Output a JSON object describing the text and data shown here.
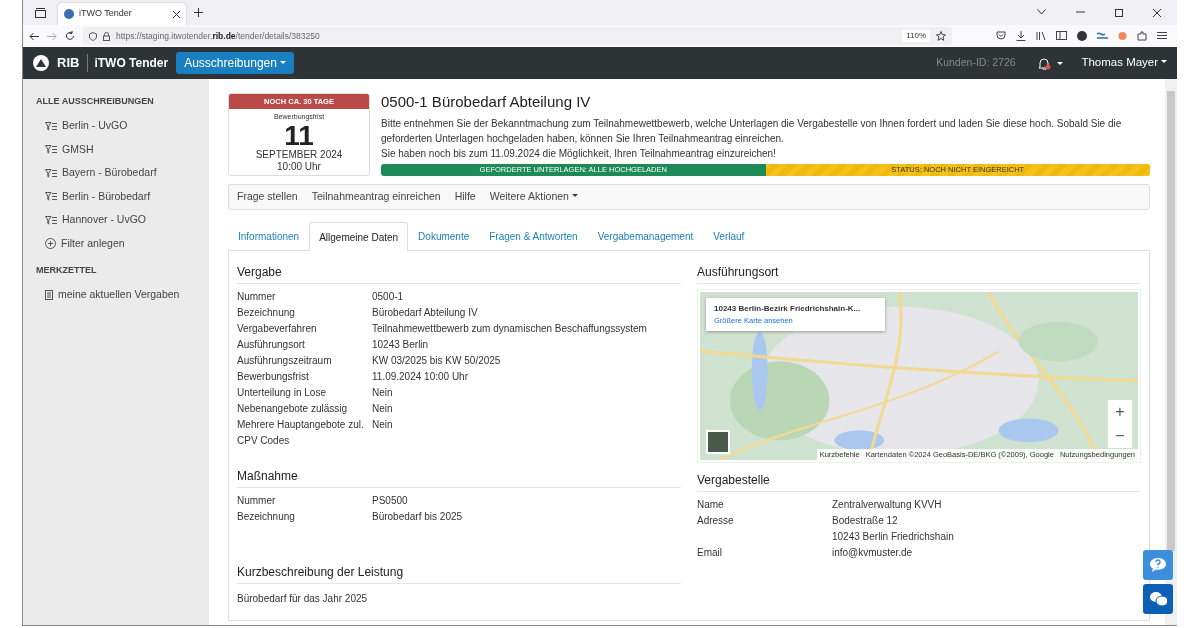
{
  "browser": {
    "tab_title": "iTWO Tender",
    "url_prefix": "https://staging.itwotender.",
    "url_domain": "rib.de",
    "url_path": "/tender/details/383250",
    "zoom": "110%"
  },
  "navbar": {
    "brand": "RIB",
    "product": "iTWO Tender",
    "menu_button": "Ausschreibungen",
    "customer_id": "Kunden-ID: 2726",
    "notification": true,
    "user": "Thomas Mayer"
  },
  "sidebar": {
    "sections": [
      {
        "heading": "ALLE AUSSCHREIBUNGEN",
        "items": [
          {
            "label": "Berlin - UvGO",
            "kind": "filter"
          },
          {
            "label": "GMSH",
            "kind": "filter"
          },
          {
            "label": "Bayern - Bürobedarf",
            "kind": "filter"
          },
          {
            "label": "Berlin - Bürobedarf",
            "kind": "filter"
          },
          {
            "label": "Hannover - UvGO",
            "kind": "filter"
          },
          {
            "label": "Filter anlegen",
            "kind": "add"
          }
        ]
      },
      {
        "heading": "MERKZETTEL",
        "items": [
          {
            "label": "meine aktuellen Vergaben",
            "kind": "document"
          }
        ]
      }
    ]
  },
  "deadline": {
    "badge": "NOCH CA. 30 TAGE",
    "label": "Bewerbungsfrist",
    "day": "11",
    "month_year": "SEPTEMBER 2024",
    "time": "10:00 Uhr"
  },
  "title": "0500-1 Bürobedarf Abteilung IV",
  "intro": [
    "Bitte entnehmen Sie der Bekanntmachung zum Teilnahmewettbewerb, welche Unterlagen die Vergabestelle von Ihnen fordert und laden Sie diese hoch. Sobald Sie die geforderten Unterlagen hochgeladen haben, können Sie Ihren Teilnahmeantrag einreichen.",
    "Sie haben noch bis zum 11.09.2024 die Möglichkeit, Ihren Teilnahmeantrag einzureichen!"
  ],
  "status_bar": [
    {
      "label": "GEFORDERTE UNTERLAGEN: ALLE HOCHGELADEN",
      "kind": "done"
    },
    {
      "label": "STATUS: NOCH NICHT EINGEREICHT",
      "kind": "pending"
    }
  ],
  "actions": [
    {
      "label": "Frage stellen",
      "dropdown": false
    },
    {
      "label": "Teilnahmeantrag einreichen",
      "dropdown": false
    },
    {
      "label": "Hilfe",
      "dropdown": false
    },
    {
      "label": "Weitere Aktionen",
      "dropdown": true
    }
  ],
  "tabs": [
    {
      "label": "Informationen",
      "selected": false
    },
    {
      "label": "Allgemeine Daten",
      "selected": true
    },
    {
      "label": "Dokumente",
      "selected": false
    },
    {
      "label": "Fragen & Antworten",
      "selected": false
    },
    {
      "label": "Vergabemanagement",
      "selected": false
    },
    {
      "label": "Verlauf",
      "selected": false
    }
  ],
  "vergabe": {
    "heading": "Vergabe",
    "rows": [
      {
        "label": "Nummer",
        "value": "0500-1"
      },
      {
        "label": "Bezeichnung",
        "value": "Bürobedarf Abteilung IV"
      },
      {
        "label": "Vergabeverfahren",
        "value": "Teilnahmewettbewerb zum dynamischen Beschaffungssystem"
      },
      {
        "label": "Ausführungsort",
        "value": "10243 Berlin"
      },
      {
        "label": "Ausführungszeitraum",
        "value": "KW 03/2025 bis KW 50/2025"
      },
      {
        "label": "Bewerbungsfrist",
        "value": "11.09.2024 10:00 Uhr"
      },
      {
        "label": "Unterteilung in Lose",
        "value": "Nein"
      },
      {
        "label": "Nebenangebote zulässig",
        "value": "Nein"
      },
      {
        "label": "Mehrere Hauptangebote zul.",
        "value": "Nein"
      },
      {
        "label": "CPV Codes"
      }
    ]
  },
  "massnahme": {
    "heading": "Maßnahme",
    "rows": [
      {
        "label": "Nummer",
        "value": "PS0500"
      },
      {
        "label": "Bezeichnung",
        "value": "Bürobedarf bis 2025"
      }
    ]
  },
  "kurzbeschreibung": {
    "heading": "Kurzbeschreibung der Leistung",
    "text": "Bürobedarf für das Jahr 2025"
  },
  "ausfuehrungsort": {
    "heading": "Ausführungsort",
    "map": {
      "kind": "picture",
      "place": "10243 Berlin-Bezirk Friedrichshain-K...",
      "link": "Größere Karte ansehen",
      "zoom_in": "+",
      "zoom_out": "−",
      "attribution": [
        "Kurzbefehle",
        "Kartendaten ©2024 GeoBasis-DE/BKG (©2009), Google",
        "Nutzungsbedingungen"
      ]
    }
  },
  "vergabestelle": {
    "heading": "Vergabestelle",
    "rows": [
      {
        "label": "Name",
        "value": "Zentralverwaltung KVVH"
      },
      {
        "label": "Adresse",
        "value": [
          "Bodestraße 12",
          "10243 Berlin Friedrichshain"
        ]
      },
      {
        "label": "Email",
        "value": "info@kvmuster.de"
      }
    ]
  }
}
